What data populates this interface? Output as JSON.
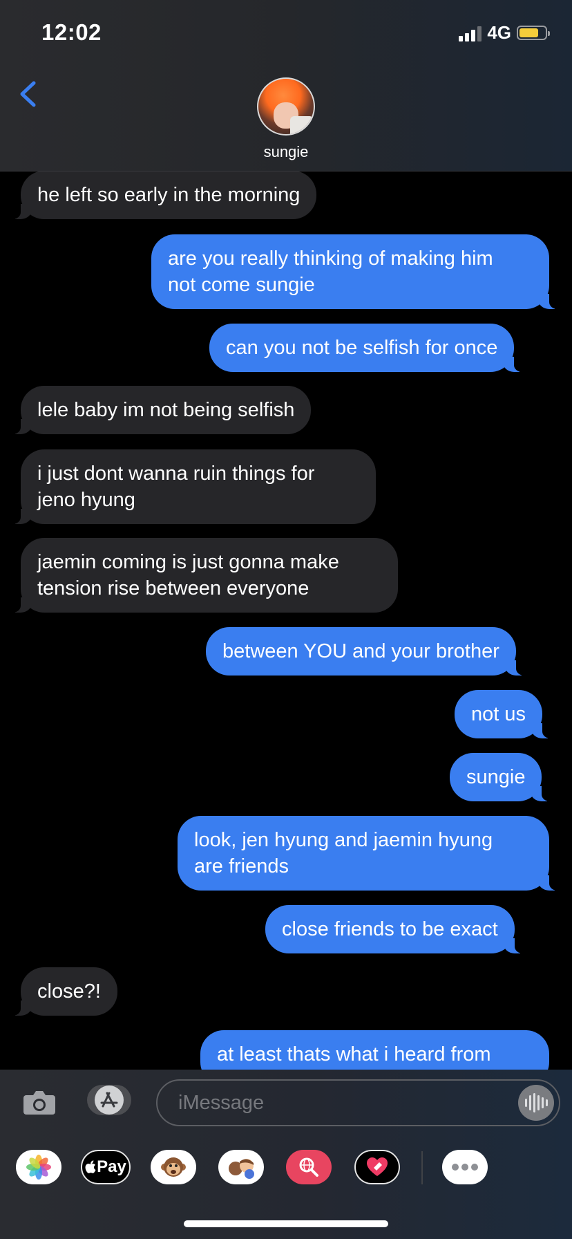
{
  "status_bar": {
    "time": "12:02",
    "network": "4G",
    "battery_color": "#f5cd3b",
    "battery_level": 0.75
  },
  "header": {
    "back_icon": "chevron-left-icon",
    "contact_name": "sungie",
    "accent_color": "#3a7ef0"
  },
  "messages": [
    {
      "side": "in",
      "text": "he left so early in the morning"
    },
    {
      "side": "out",
      "text": "are you really thinking of making him\nnot come sungie"
    },
    {
      "side": "out",
      "text": "can you not be selfish for once"
    },
    {
      "side": "in",
      "text": "lele baby im not being selfish"
    },
    {
      "side": "in",
      "text": "i just dont wanna ruin things for\njeno hyung"
    },
    {
      "side": "in",
      "text": "jaemin coming is just gonna make\ntension rise between everyone"
    },
    {
      "side": "out",
      "text": "between YOU and your brother"
    },
    {
      "side": "out",
      "text": "not us"
    },
    {
      "side": "out",
      "text": "sungie"
    },
    {
      "side": "out",
      "text": "look, jen hyung and jaemin hyung\nare friends"
    },
    {
      "side": "out",
      "text": "close friends to be exact"
    },
    {
      "side": "in",
      "text": "close?!"
    },
    {
      "side": "out",
      "text": "at least thats what i heard from"
    }
  ],
  "compose": {
    "placeholder": "iMessage",
    "camera_icon": "camera-icon",
    "app_store_icon": "app-store-icon",
    "audio_icon": "audio-waveform-icon"
  },
  "app_tray": [
    {
      "name": "photos-app",
      "icon": "photos-icon",
      "label": ""
    },
    {
      "name": "apple-pay-app",
      "icon": "apple-pay-icon",
      "label": "Pay"
    },
    {
      "name": "animoji-app",
      "icon": "monkey-icon",
      "label": ""
    },
    {
      "name": "memoji-app",
      "icon": "memoji-icon",
      "label": ""
    },
    {
      "name": "images-search-app",
      "icon": "search-globe-icon",
      "label": ""
    },
    {
      "name": "digital-touch-app",
      "icon": "heart-icon",
      "label": ""
    },
    {
      "name": "more-apps",
      "icon": "more-icon",
      "label": ""
    }
  ]
}
